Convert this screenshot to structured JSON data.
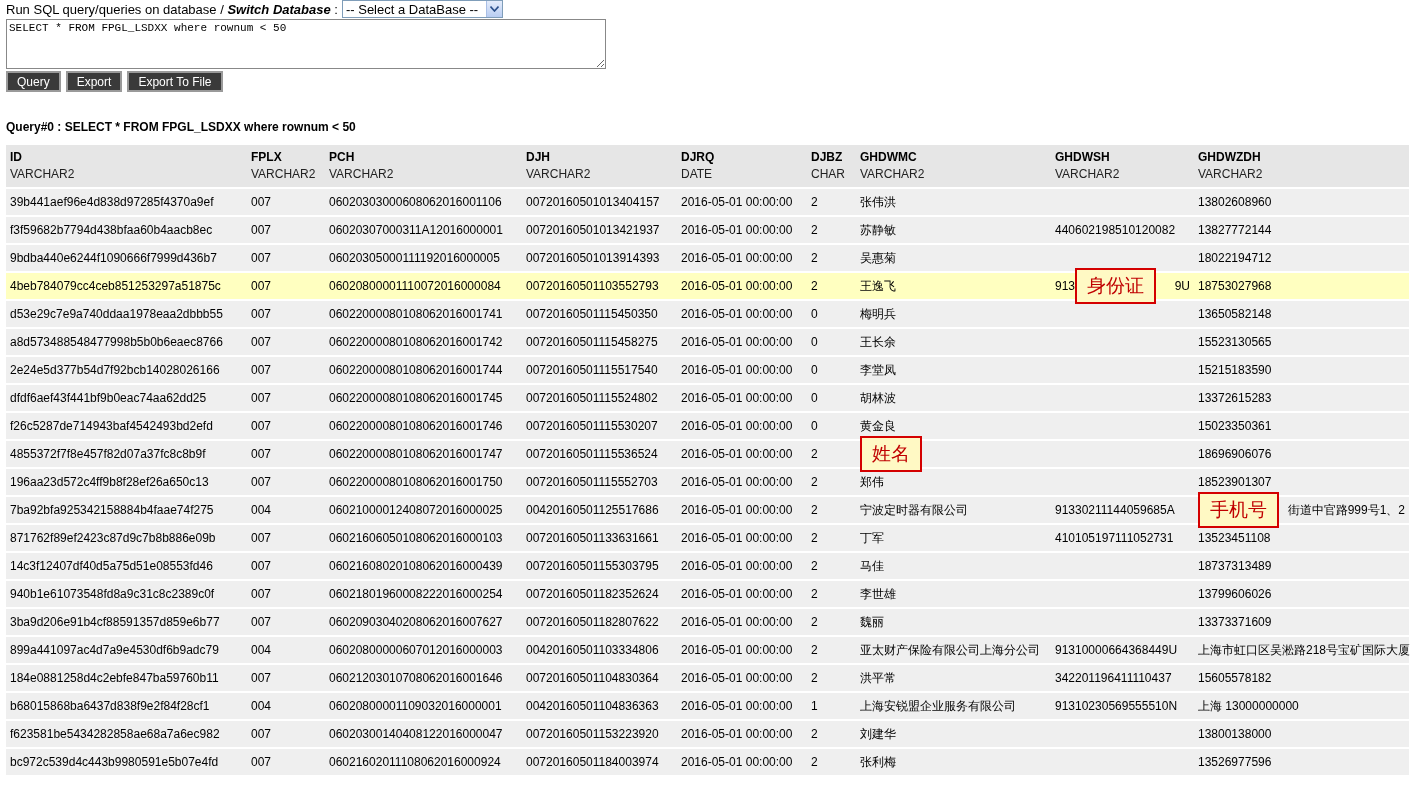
{
  "header": {
    "intro": "Run SQL query/queries on database / **Switch Database** :",
    "database_select": {
      "value": "-- Select a DataBase --"
    },
    "sql_input": {
      "value": "SELECT * FROM FPGL_LSDXX where rownum < 50"
    },
    "buttons": [
      "Query",
      "Export",
      "Export To File"
    ]
  },
  "query_title": "Query#0 : SELECT * FROM FPGL_LSDXX where rownum < 50",
  "table": {
    "columns": [
      {
        "name": "ID",
        "type": "VARCHAR2"
      },
      {
        "name": "FPLX",
        "type": "VARCHAR2"
      },
      {
        "name": "PCH",
        "type": "VARCHAR2"
      },
      {
        "name": "DJH",
        "type": "VARCHAR2"
      },
      {
        "name": "DJRQ",
        "type": "DATE"
      },
      {
        "name": "DJBZ",
        "type": "CHAR"
      },
      {
        "name": "GHDWMC",
        "type": "VARCHAR2"
      },
      {
        "name": "GHDWSH",
        "type": "VARCHAR2"
      },
      {
        "name": "GHDWZDH",
        "type": "VARCHAR2"
      }
    ],
    "rows": [
      {
        "selected": false,
        "cells": [
          "39b441aef96e4d838d97285f4370a9ef",
          "007",
          "06020303000608062016001106",
          "00720160501013404157",
          "2016-05-01 00:00:00",
          "2",
          "张伟洪",
          null,
          "13802608960"
        ]
      },
      {
        "selected": false,
        "cells": [
          "f3f59682b7794d438bfaa60b4aacb8ec",
          "007",
          "06020307000311A12016000001",
          "00720160501013421937",
          "2016-05-01 00:00:00",
          "2",
          "苏静敏",
          "440602198510120082",
          "13827772144"
        ]
      },
      {
        "selected": false,
        "cells": [
          "9bdba440e6244f1090666f7999d436b7",
          "007",
          "06020305000111192016000005",
          "00720160501013914393",
          "2016-05-01 00:00:00",
          "2",
          "吴惠菊",
          null,
          "18022194712"
        ]
      },
      {
        "selected": true,
        "cells": [
          "4beb784079cc4ceb851253297a51875c",
          "007",
          "06020800001110072016000084",
          "00720160501103552793",
          "2016-05-01 00:00:00",
          "2",
          "王逸飞",
          {
            "before": "913",
            "note": "身份证",
            "after": "9U"
          },
          "18753027968"
        ]
      },
      {
        "selected": false,
        "cells": [
          "d53e29c7e9a740ddaa1978eaa2dbbb55",
          "007",
          "06022000080108062016001741",
          "00720160501115450350",
          "2016-05-01 00:00:00",
          "0",
          "梅明兵",
          null,
          "13650582148"
        ]
      },
      {
        "selected": false,
        "cells": [
          "a8d573488548477998b5b0b6eaec8766",
          "007",
          "06022000080108062016001742",
          "00720160501115458275",
          "2016-05-01 00:00:00",
          "0",
          "王长余",
          null,
          "15523130565"
        ]
      },
      {
        "selected": false,
        "cells": [
          "2e24e5d377b54d7f92bcb14028026166",
          "007",
          "06022000080108062016001744",
          "00720160501115517540",
          "2016-05-01 00:00:00",
          "0",
          "李堂凤",
          null,
          "15215183590"
        ]
      },
      {
        "selected": false,
        "cells": [
          "dfdf6aef43f441bf9b0eac74aa62dd25",
          "007",
          "06022000080108062016001745",
          "00720160501115524802",
          "2016-05-01 00:00:00",
          "0",
          "胡林波",
          null,
          "13372615283"
        ]
      },
      {
        "selected": false,
        "cells": [
          "f26c5287de714943baf4542493bd2efd",
          "007",
          "06022000080108062016001746",
          "00720160501115530207",
          "2016-05-01 00:00:00",
          "0",
          "黄金良",
          null,
          "15023350361"
        ]
      },
      {
        "selected": false,
        "cells": [
          "4855372f7f8e457f82d07a37fc8c8b9f",
          "007",
          "06022000080108062016001747",
          "00720160501115536524",
          "2016-05-01 00:00:00",
          "2",
          {
            "note": "姓名"
          },
          null,
          "18696906076"
        ]
      },
      {
        "selected": false,
        "cells": [
          "196aa23d572c4ff9b8f28ef26a650c13",
          "007",
          "06022000080108062016001750",
          "00720160501115552703",
          "2016-05-01 00:00:00",
          "2",
          "郑伟",
          null,
          "18523901307"
        ]
      },
      {
        "selected": false,
        "cells": [
          "7ba92bfa925342158884b4faae74f275",
          "004",
          "06021000012408072016000025",
          "00420160501125517686",
          "2016-05-01 00:00:00",
          "2",
          "宁波定时器有限公司",
          "91330211144059685A",
          {
            "note": "手机号",
            "after": "街道中官路999号1、2"
          }
        ]
      },
      {
        "selected": false,
        "cells": [
          "871762f89ef2423c87d9c7b8b886e09b",
          "007",
          "06021606050108062016000103",
          "00720160501133631661",
          "2016-05-01 00:00:00",
          "2",
          "丁军",
          "410105197111052731",
          "13523451108"
        ]
      },
      {
        "selected": false,
        "cells": [
          "14c3f12407df40d5a75d51e08553fd46",
          "007",
          "06021608020108062016000439",
          "00720160501155303795",
          "2016-05-01 00:00:00",
          "2",
          "马佳",
          null,
          "18737313489"
        ]
      },
      {
        "selected": false,
        "cells": [
          "940b1e61073548fd8a9c31c8c2389c0f",
          "007",
          "06021801960008222016000254",
          "00720160501182352624",
          "2016-05-01 00:00:00",
          "2",
          "李世雄",
          null,
          "13799606026"
        ]
      },
      {
        "selected": false,
        "cells": [
          "3ba9d206e91b4cf88591357d859e6b77",
          "007",
          "06020903040208062016007627",
          "00720160501182807622",
          "2016-05-01 00:00:00",
          "2",
          "魏丽",
          null,
          "13373371609"
        ]
      },
      {
        "selected": false,
        "cells": [
          "899a441097ac4d7a9e4530df6b9adc79",
          "004",
          "06020800000607012016000003",
          "00420160501103334806",
          "2016-05-01 00:00:00",
          "2",
          "亚太财产保险有限公司上海分公司",
          "91310000664368449U",
          "上海市虹口区吴淞路218号宝矿国际大厦"
        ]
      },
      {
        "selected": false,
        "cells": [
          "184e0881258d4c2ebfe847ba59760b11",
          "007",
          "06021203010708062016001646",
          "00720160501104830364",
          "2016-05-01 00:00:00",
          "2",
          "洪平常",
          "342201196411110437",
          "15605578182"
        ]
      },
      {
        "selected": false,
        "cells": [
          "b68015868ba6437d838f9e2f84f28cf1",
          "004",
          "06020800001109032016000001",
          "00420160501104836363",
          "2016-05-01 00:00:00",
          "1",
          "上海安锐盟企业服务有限公司",
          "91310230569555510N",
          "上海 13000000000"
        ]
      },
      {
        "selected": false,
        "cells": [
          "f623581be5434282858ae68a7a6ec982",
          "007",
          "06020300140408122016000047",
          "00720160501153223920",
          "2016-05-01 00:00:00",
          "2",
          "刘建华",
          null,
          "13800138000"
        ]
      },
      {
        "selected": false,
        "cells": [
          "bc972c539d4c443b9980591e5b07e4fd",
          "007",
          "06021602011108062016000924",
          "00720160501184003974",
          "2016-05-01 00:00:00",
          "2",
          "张利梅",
          null,
          "13526977596"
        ]
      }
    ]
  }
}
